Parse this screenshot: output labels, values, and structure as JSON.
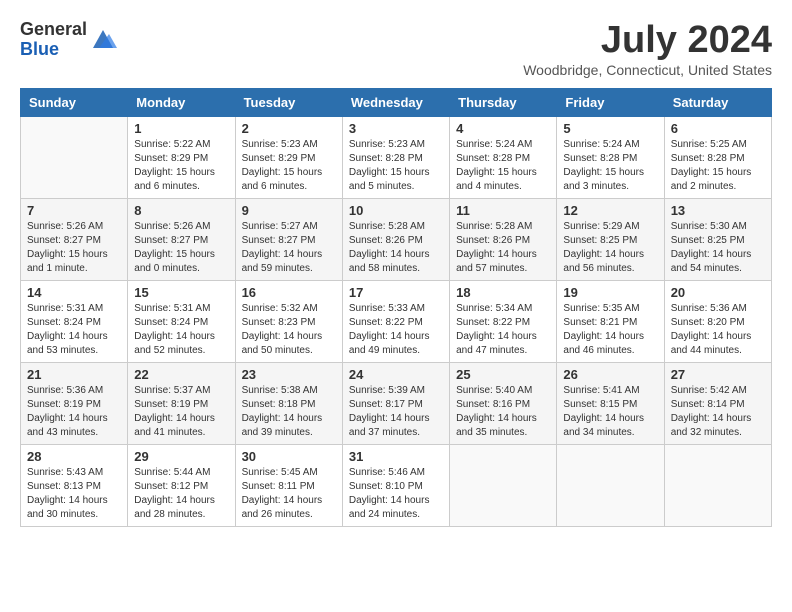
{
  "logo": {
    "general": "General",
    "blue": "Blue"
  },
  "title": "July 2024",
  "location": "Woodbridge, Connecticut, United States",
  "days_of_week": [
    "Sunday",
    "Monday",
    "Tuesday",
    "Wednesday",
    "Thursday",
    "Friday",
    "Saturday"
  ],
  "weeks": [
    [
      {
        "day": "",
        "info": ""
      },
      {
        "day": "1",
        "info": "Sunrise: 5:22 AM\nSunset: 8:29 PM\nDaylight: 15 hours\nand 6 minutes."
      },
      {
        "day": "2",
        "info": "Sunrise: 5:23 AM\nSunset: 8:29 PM\nDaylight: 15 hours\nand 6 minutes."
      },
      {
        "day": "3",
        "info": "Sunrise: 5:23 AM\nSunset: 8:28 PM\nDaylight: 15 hours\nand 5 minutes."
      },
      {
        "day": "4",
        "info": "Sunrise: 5:24 AM\nSunset: 8:28 PM\nDaylight: 15 hours\nand 4 minutes."
      },
      {
        "day": "5",
        "info": "Sunrise: 5:24 AM\nSunset: 8:28 PM\nDaylight: 15 hours\nand 3 minutes."
      },
      {
        "day": "6",
        "info": "Sunrise: 5:25 AM\nSunset: 8:28 PM\nDaylight: 15 hours\nand 2 minutes."
      }
    ],
    [
      {
        "day": "7",
        "info": "Sunrise: 5:26 AM\nSunset: 8:27 PM\nDaylight: 15 hours\nand 1 minute."
      },
      {
        "day": "8",
        "info": "Sunrise: 5:26 AM\nSunset: 8:27 PM\nDaylight: 15 hours\nand 0 minutes."
      },
      {
        "day": "9",
        "info": "Sunrise: 5:27 AM\nSunset: 8:27 PM\nDaylight: 14 hours\nand 59 minutes."
      },
      {
        "day": "10",
        "info": "Sunrise: 5:28 AM\nSunset: 8:26 PM\nDaylight: 14 hours\nand 58 minutes."
      },
      {
        "day": "11",
        "info": "Sunrise: 5:28 AM\nSunset: 8:26 PM\nDaylight: 14 hours\nand 57 minutes."
      },
      {
        "day": "12",
        "info": "Sunrise: 5:29 AM\nSunset: 8:25 PM\nDaylight: 14 hours\nand 56 minutes."
      },
      {
        "day": "13",
        "info": "Sunrise: 5:30 AM\nSunset: 8:25 PM\nDaylight: 14 hours\nand 54 minutes."
      }
    ],
    [
      {
        "day": "14",
        "info": "Sunrise: 5:31 AM\nSunset: 8:24 PM\nDaylight: 14 hours\nand 53 minutes."
      },
      {
        "day": "15",
        "info": "Sunrise: 5:31 AM\nSunset: 8:24 PM\nDaylight: 14 hours\nand 52 minutes."
      },
      {
        "day": "16",
        "info": "Sunrise: 5:32 AM\nSunset: 8:23 PM\nDaylight: 14 hours\nand 50 minutes."
      },
      {
        "day": "17",
        "info": "Sunrise: 5:33 AM\nSunset: 8:22 PM\nDaylight: 14 hours\nand 49 minutes."
      },
      {
        "day": "18",
        "info": "Sunrise: 5:34 AM\nSunset: 8:22 PM\nDaylight: 14 hours\nand 47 minutes."
      },
      {
        "day": "19",
        "info": "Sunrise: 5:35 AM\nSunset: 8:21 PM\nDaylight: 14 hours\nand 46 minutes."
      },
      {
        "day": "20",
        "info": "Sunrise: 5:36 AM\nSunset: 8:20 PM\nDaylight: 14 hours\nand 44 minutes."
      }
    ],
    [
      {
        "day": "21",
        "info": "Sunrise: 5:36 AM\nSunset: 8:19 PM\nDaylight: 14 hours\nand 43 minutes."
      },
      {
        "day": "22",
        "info": "Sunrise: 5:37 AM\nSunset: 8:19 PM\nDaylight: 14 hours\nand 41 minutes."
      },
      {
        "day": "23",
        "info": "Sunrise: 5:38 AM\nSunset: 8:18 PM\nDaylight: 14 hours\nand 39 minutes."
      },
      {
        "day": "24",
        "info": "Sunrise: 5:39 AM\nSunset: 8:17 PM\nDaylight: 14 hours\nand 37 minutes."
      },
      {
        "day": "25",
        "info": "Sunrise: 5:40 AM\nSunset: 8:16 PM\nDaylight: 14 hours\nand 35 minutes."
      },
      {
        "day": "26",
        "info": "Sunrise: 5:41 AM\nSunset: 8:15 PM\nDaylight: 14 hours\nand 34 minutes."
      },
      {
        "day": "27",
        "info": "Sunrise: 5:42 AM\nSunset: 8:14 PM\nDaylight: 14 hours\nand 32 minutes."
      }
    ],
    [
      {
        "day": "28",
        "info": "Sunrise: 5:43 AM\nSunset: 8:13 PM\nDaylight: 14 hours\nand 30 minutes."
      },
      {
        "day": "29",
        "info": "Sunrise: 5:44 AM\nSunset: 8:12 PM\nDaylight: 14 hours\nand 28 minutes."
      },
      {
        "day": "30",
        "info": "Sunrise: 5:45 AM\nSunset: 8:11 PM\nDaylight: 14 hours\nand 26 minutes."
      },
      {
        "day": "31",
        "info": "Sunrise: 5:46 AM\nSunset: 8:10 PM\nDaylight: 14 hours\nand 24 minutes."
      },
      {
        "day": "",
        "info": ""
      },
      {
        "day": "",
        "info": ""
      },
      {
        "day": "",
        "info": ""
      }
    ]
  ]
}
